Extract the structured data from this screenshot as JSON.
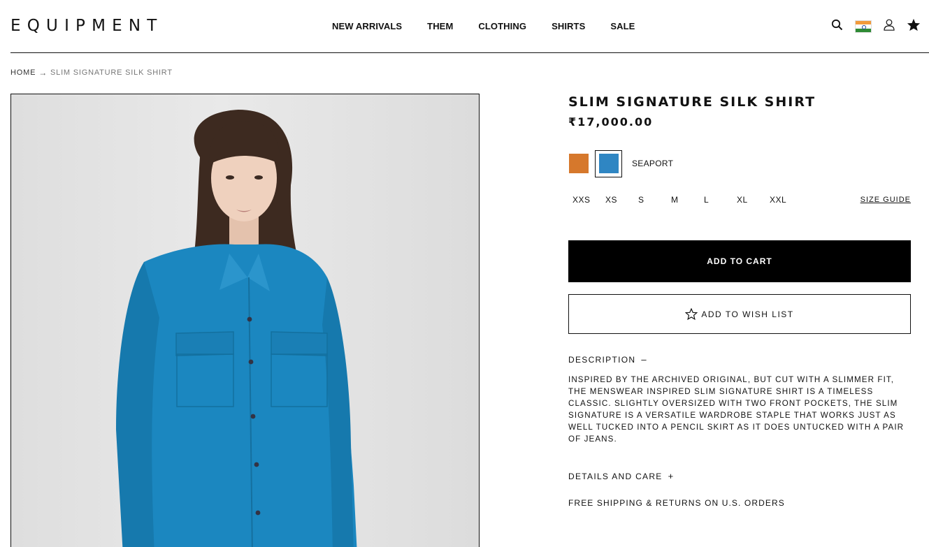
{
  "brand": {
    "logo_text": "EQUIPMENT"
  },
  "nav": {
    "items": [
      {
        "label": "NEW ARRIVALS"
      },
      {
        "label": "THEM"
      },
      {
        "label": "CLOTHING"
      },
      {
        "label": "SHIRTS"
      },
      {
        "label": "SALE"
      }
    ]
  },
  "header_icons": [
    "search-icon",
    "india-flag-icon",
    "account-icon",
    "wishlist-star-icon"
  ],
  "breadcrumb": {
    "home": "HOME",
    "current": "SLIM SIGNATURE SILK SHIRT"
  },
  "product": {
    "title": "SLIM SIGNATURE SILK SHIRT",
    "price": "₹17,000.00",
    "selected_color": "SEAPORT",
    "colors": [
      {
        "name": "orange",
        "hex": "#d6782c"
      },
      {
        "name": "SEAPORT",
        "hex": "#2f86c3"
      }
    ],
    "sizes": [
      "XXS",
      "XS",
      "S",
      "M",
      "L",
      "XL",
      "XXL"
    ],
    "size_guide": "SIZE GUIDE",
    "add_to_cart": "ADD TO CART",
    "add_to_wishlist": "ADD TO WISH LIST",
    "description_label": "DESCRIPTION",
    "description_toggle": "–",
    "description": "INSPIRED BY THE ARCHIVED ORIGINAL, BUT CUT WITH A SLIMMER FIT, THE MENSWEAR INSPIRED SLIM SIGNATURE SHIRT IS A TIMELESS CLASSIC. SLIGHTLY OVERSIZED WITH TWO FRONT POCKETS, THE SLIM SIGNATURE IS A VERSATILE WARDROBE STAPLE THAT WORKS JUST AS WELL TUCKED INTO A PENCIL SKIRT AS IT DOES UNTUCKED WITH A PAIR OF JEANS.",
    "details_label": "DETAILS AND CARE",
    "details_toggle": "+",
    "shipping_note": "FREE SHIPPING & RETURNS ON U.S. ORDERS"
  },
  "colors": {
    "text": "#111111",
    "button_bg": "#000000",
    "shirt": "#1b87c0",
    "hair": "#3d2a20"
  }
}
